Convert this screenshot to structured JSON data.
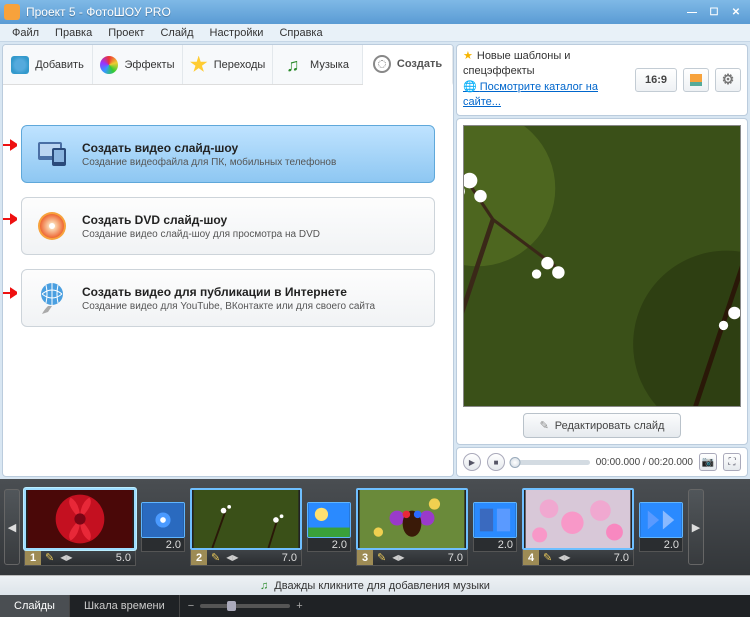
{
  "title": "Проект 5 - ФотоШОУ PRO",
  "menu": [
    "Файл",
    "Правка",
    "Проект",
    "Слайд",
    "Настройки",
    "Справка"
  ],
  "tabs": {
    "add": "Добавить",
    "effects": "Эффекты",
    "transitions": "Переходы",
    "music": "Музыка",
    "create": "Создать"
  },
  "create_options": [
    {
      "title": "Создать видео слайд-шоу",
      "desc": "Создание видеофайла для ПК, мобильных телефонов"
    },
    {
      "title": "Создать DVD слайд-шоу",
      "desc": "Создание видео слайд-шоу для просмотра на DVD"
    },
    {
      "title": "Создать видео для публикации в Интернете",
      "desc": "Создание видео для YouTube, ВКонтакте или для своего сайта"
    }
  ],
  "info": {
    "line1": "Новые шаблоны и спецэффекты",
    "line2": "Посмотрите каталог на сайте..."
  },
  "aspect": "16:9",
  "edit_slide": "Редактировать слайд",
  "playback": {
    "time": "00:00.000 / 00:20.000"
  },
  "music_hint": "Дважды кликните для добавления музыки",
  "bottom_tabs": {
    "slides": "Слайды",
    "timeline": "Шкала времени"
  },
  "slides": [
    {
      "n": "1",
      "dur": "5.0",
      "trans": "2.0"
    },
    {
      "n": "2",
      "dur": "7.0",
      "trans": "2.0"
    },
    {
      "n": "3",
      "dur": "7.0",
      "trans": "2.0"
    },
    {
      "n": "4",
      "dur": "7.0",
      "trans": "2.0"
    }
  ]
}
